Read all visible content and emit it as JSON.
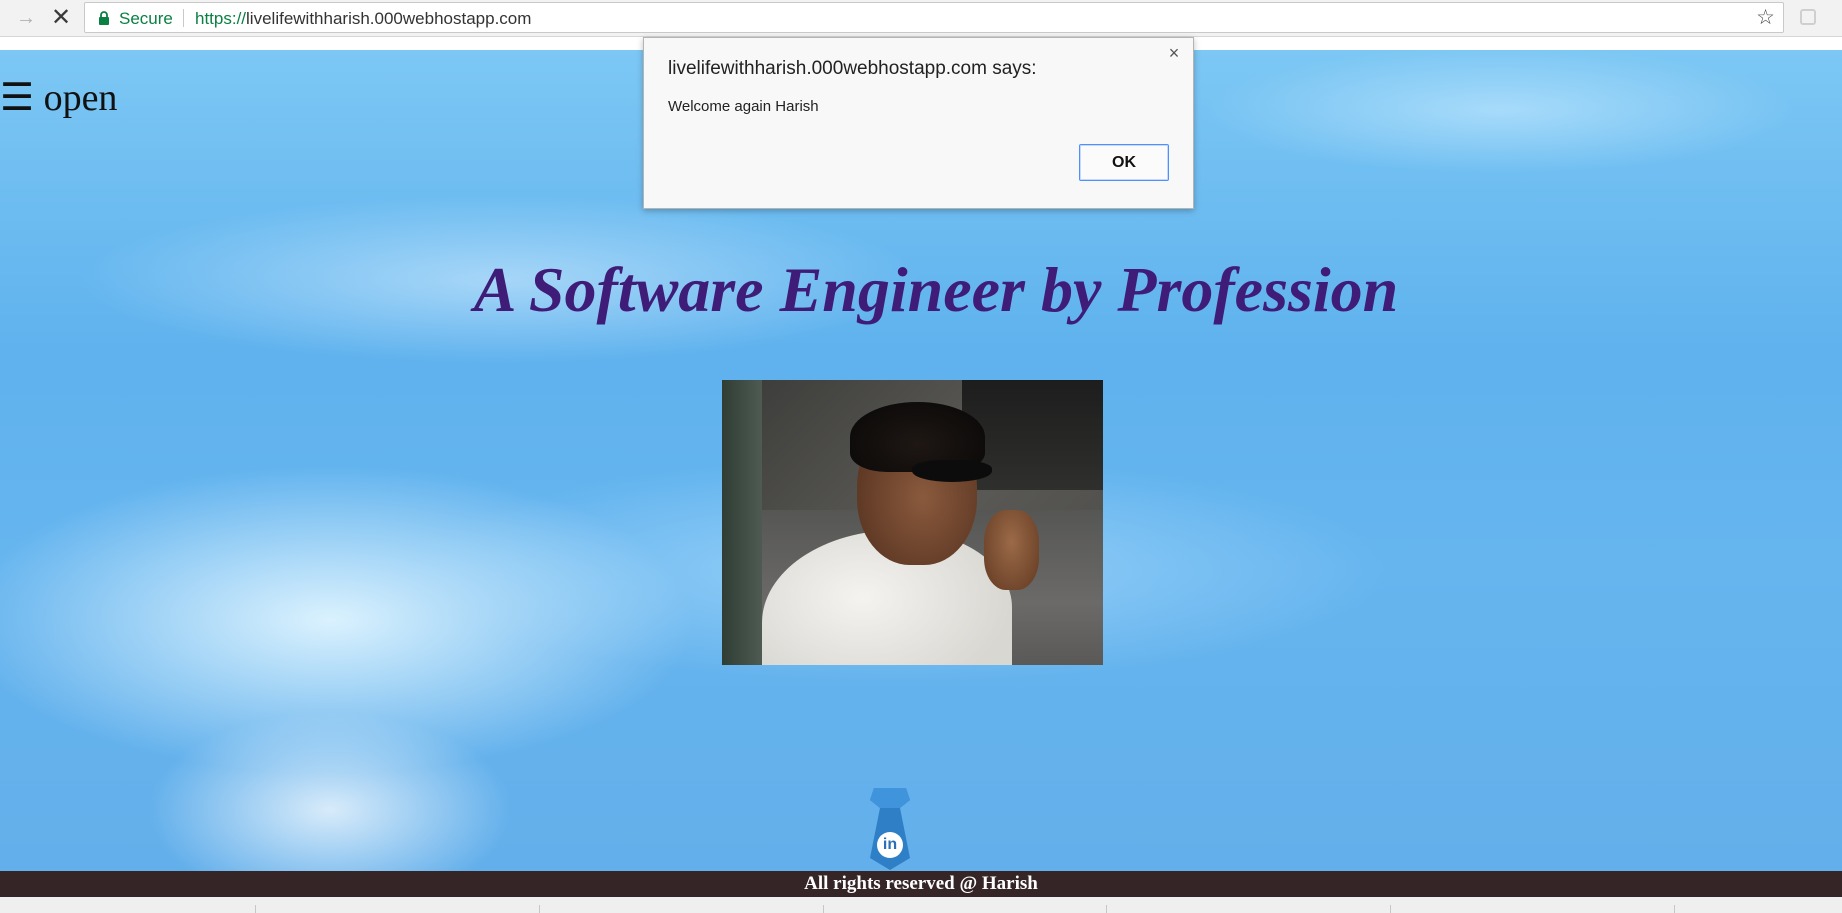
{
  "browser": {
    "secure_label": "Secure",
    "url_scheme": "https://",
    "url_host": "livelifewithharish.000webhostapp.com",
    "forward_icon": "arrow-forward-icon",
    "stop_icon": "stop-loading-icon",
    "lock_icon": "lock-icon",
    "star_icon": "bookmark-star-icon"
  },
  "page": {
    "menu_label": "☰ open",
    "headline": "A Software Engineer by Profession",
    "footer": "All rights reserved @ Harish",
    "linkedin_label": "in",
    "colors": {
      "headline": "#3f1c78",
      "footer_bg": "#352527",
      "sky": "#62aeea"
    }
  },
  "dialog": {
    "title": "livelifewithharish.000webhostapp.com says:",
    "message": "Welcome again Harish",
    "ok_label": "OK",
    "close_icon": "close-icon"
  }
}
